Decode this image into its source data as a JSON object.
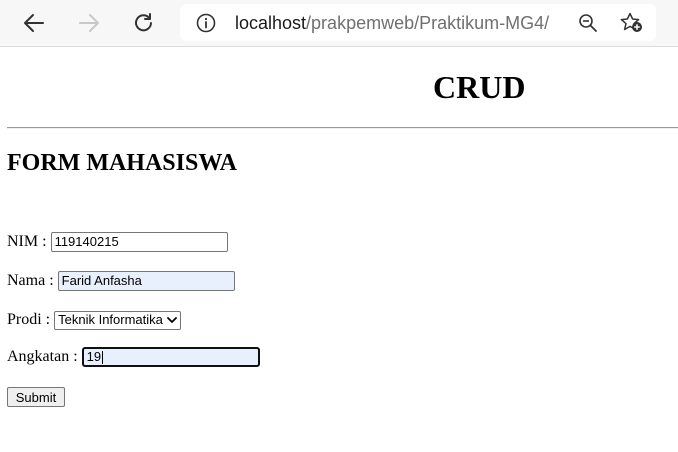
{
  "browser": {
    "url_host": "localhost",
    "url_path": "/prakpemweb/Praktikum-MG4/",
    "icons": [
      "back-icon",
      "forward-icon",
      "reload-icon",
      "info-icon",
      "zoom-icon",
      "favorite-add-icon"
    ]
  },
  "page": {
    "title": "CRUD",
    "form_title": "FORM MAHASISWA"
  },
  "form": {
    "nim_label": "NIM :",
    "nim_value": "119140215",
    "nama_label": "Nama :",
    "nama_value": "Farid Anfasha",
    "prodi_label": "Prodi :",
    "prodi_selected": "Teknik Informatika",
    "angkatan_label": "Angkatan :",
    "angkatan_value": "19",
    "submit_label": "Submit"
  }
}
